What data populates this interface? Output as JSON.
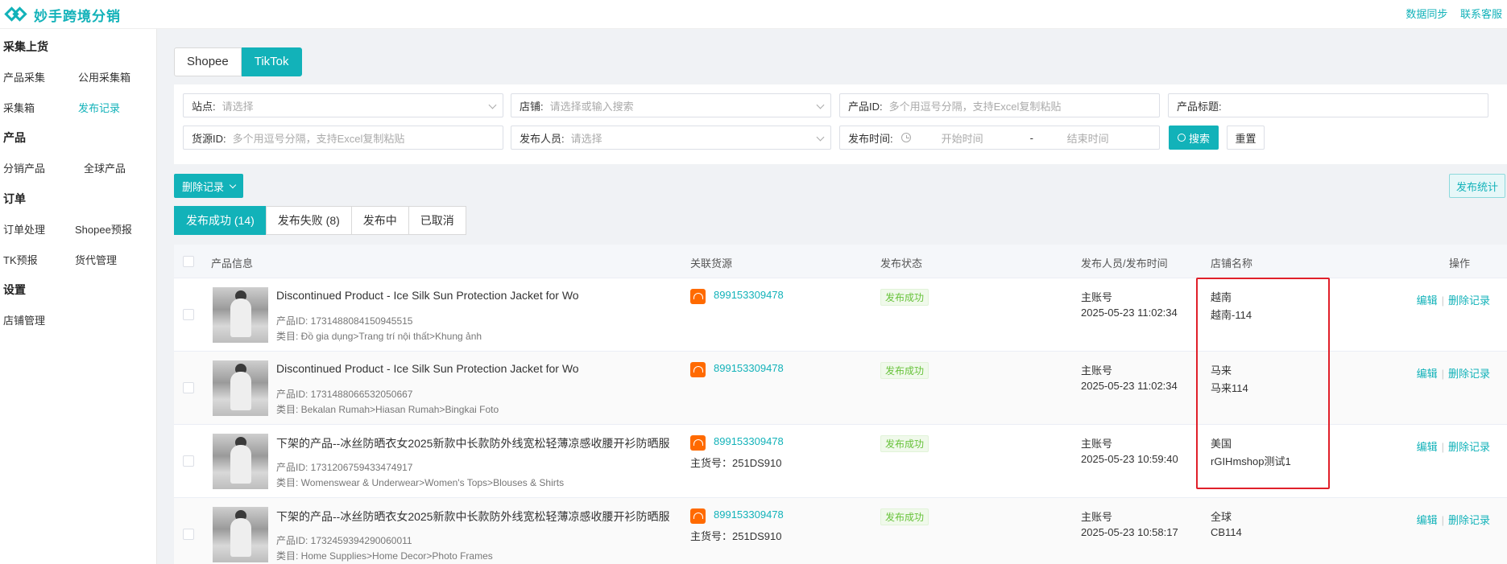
{
  "app": {
    "title": "妙手跨境分销"
  },
  "header": {
    "links": [
      "数据同步",
      "联系客服"
    ]
  },
  "sidebar": {
    "sections": [
      {
        "title": "采集上货",
        "items": [
          "产品采集",
          "公用采集箱",
          "采集箱",
          "发布记录"
        ]
      },
      {
        "title": "产品",
        "items": [
          "分销产品",
          "全球产品"
        ]
      },
      {
        "title": "订单",
        "items": [
          "订单处理",
          "Shopee预报",
          "TK预报",
          "货代管理"
        ]
      },
      {
        "title": "设置",
        "items": [
          "店铺管理"
        ]
      }
    ],
    "active_item": "发布记录"
  },
  "platform_tabs": [
    "Shopee",
    "TikTok"
  ],
  "active_platform": "TikTok",
  "filters": {
    "site": {
      "label": "站点:",
      "placeholder": "请选择"
    },
    "store": {
      "label": "店铺:",
      "placeholder": "请选择或输入搜索"
    },
    "product_id": {
      "label": "产品ID:",
      "placeholder": "多个用逗号分隔，支持Excel复制粘贴"
    },
    "product_title": {
      "label": "产品标题:",
      "placeholder": ""
    },
    "goods_id": {
      "label": "货源ID:",
      "placeholder": "多个用逗号分隔，支持Excel复制粘贴"
    },
    "publisher": {
      "label": "发布人员:",
      "placeholder": "请选择"
    },
    "publish_time": {
      "label": "发布时间:",
      "start": "开始时间",
      "separator": "-",
      "end": "结束时间"
    },
    "search_label": "搜索",
    "reset_label": "重置"
  },
  "actions": {
    "delete_records": "删除记录",
    "publish_stats": "发布统计"
  },
  "status_tabs": [
    "发布成功 (14)",
    "发布失败 (8)",
    "发布中",
    "已取消"
  ],
  "active_status_tab": "发布成功 (14)",
  "table": {
    "columns": [
      "产品信息",
      "关联货源",
      "发布状态",
      "发布人员/发布时间",
      "店铺名称",
      "操作"
    ],
    "rows": [
      {
        "title": "Discontinued Product - Ice Silk Sun Protection Jacket for Wo",
        "product_id": "产品ID: 1731488084150945515",
        "category": "类目: Đồ gia dụng>Trang trí nội thất>Khung ảnh",
        "source_id": "899153309478",
        "goods_no": "",
        "status": "发布成功",
        "publisher": "主账号",
        "time": "2025-05-23 11:02:34",
        "store_region": "越南",
        "store_name": "越南-114",
        "edit": "编辑",
        "delete": "删除记录"
      },
      {
        "title": "Discontinued Product - Ice Silk Sun Protection Jacket for Wo",
        "product_id": "产品ID: 1731488066532050667",
        "category": "类目: Bekalan Rumah>Hiasan Rumah>Bingkai Foto",
        "source_id": "899153309478",
        "goods_no": "",
        "status": "发布成功",
        "publisher": "主账号",
        "time": "2025-05-23 11:02:34",
        "store_region": "马来",
        "store_name": "马来114",
        "edit": "编辑",
        "delete": "删除记录"
      },
      {
        "title": "下架的产品--冰丝防晒衣女2025新款中长款防外线宽松轻薄凉感收腰开衫防晒服",
        "product_id": "产品ID: 1731206759433474917",
        "category": "类目: Womenswear & Underwear>Women's Tops>Blouses & Shirts",
        "source_id": "899153309478",
        "goods_no": "主货号：251DS910",
        "status": "发布成功",
        "publisher": "主账号",
        "time": "2025-05-23 10:59:40",
        "store_region": "美国",
        "store_name": "rGIHmshop测试1",
        "edit": "编辑",
        "delete": "删除记录"
      },
      {
        "title": "下架的产品--冰丝防晒衣女2025新款中长款防外线宽松轻薄凉感收腰开衫防晒服",
        "product_id": "产品ID: 1732459394290060011",
        "category": "类目: Home Supplies>Home Decor>Photo Frames",
        "source_id": "899153309478",
        "goods_no": "主货号：251DS910",
        "status": "发布成功",
        "publisher": "主账号",
        "time": "2025-05-23 10:58:17",
        "store_region": "全球",
        "store_name": "CB114",
        "edit": "编辑",
        "delete": "删除记录"
      }
    ]
  },
  "colors": {
    "accent": "#12b2b9",
    "success": "#67c23a",
    "highlight": "#e0202a",
    "source_icon": "#ff6a00"
  },
  "icons": [
    "logo-icon",
    "chevron-down-icon",
    "clock-icon",
    "search-icon",
    "alibaba-1688-icon"
  ]
}
